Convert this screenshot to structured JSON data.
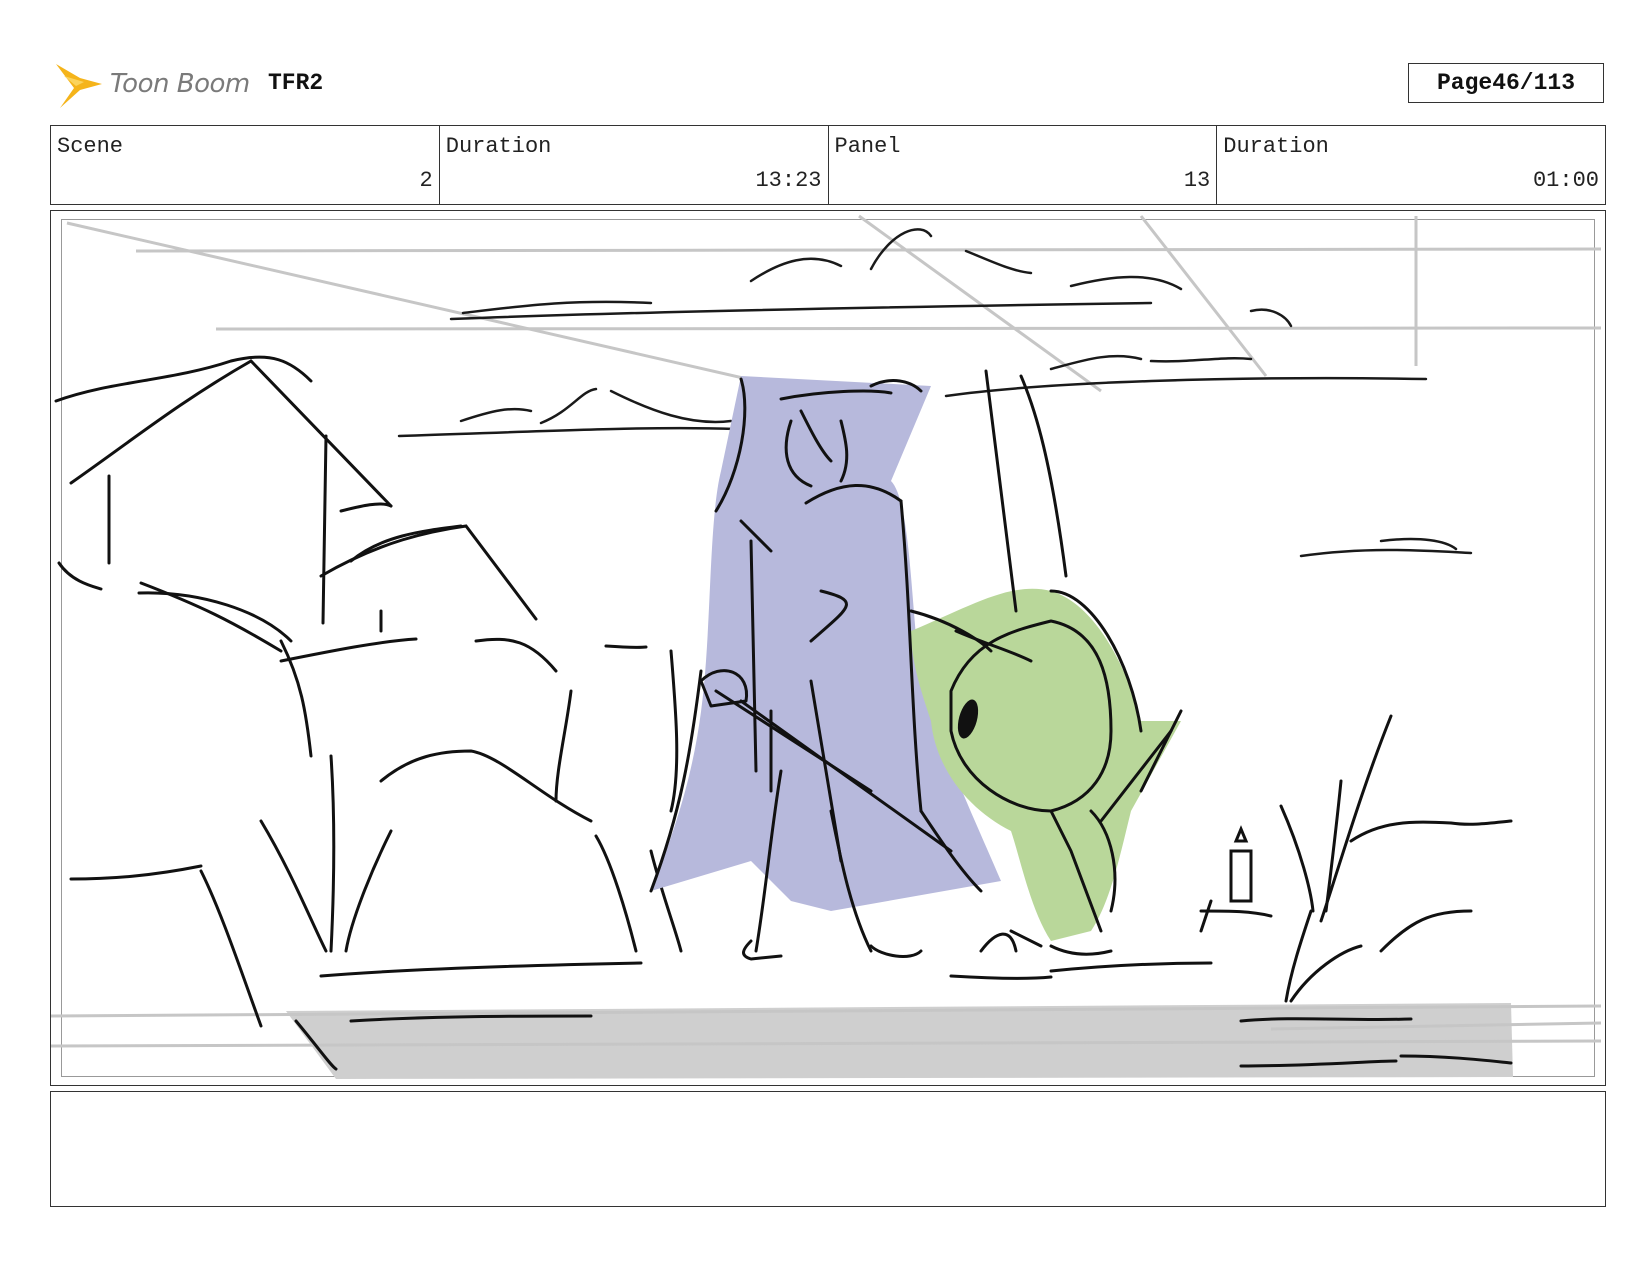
{
  "header": {
    "logo_text": "Toon Boom",
    "project": "TFR2",
    "page_label": "Page",
    "page_value": "46/113"
  },
  "info": {
    "scene_label": "Scene",
    "scene_value": "2",
    "scene_duration_label": "Duration",
    "scene_duration_value": "13:23",
    "panel_label": "Panel",
    "panel_value": "13",
    "panel_duration_label": "Duration",
    "panel_duration_value": "01:00"
  },
  "notes": {
    "text": ""
  },
  "colors": {
    "logo_star": "#f5b41a",
    "cloak": "#b7b9dc",
    "creature": "#b9d79a",
    "ground": "#cfcfcf"
  }
}
